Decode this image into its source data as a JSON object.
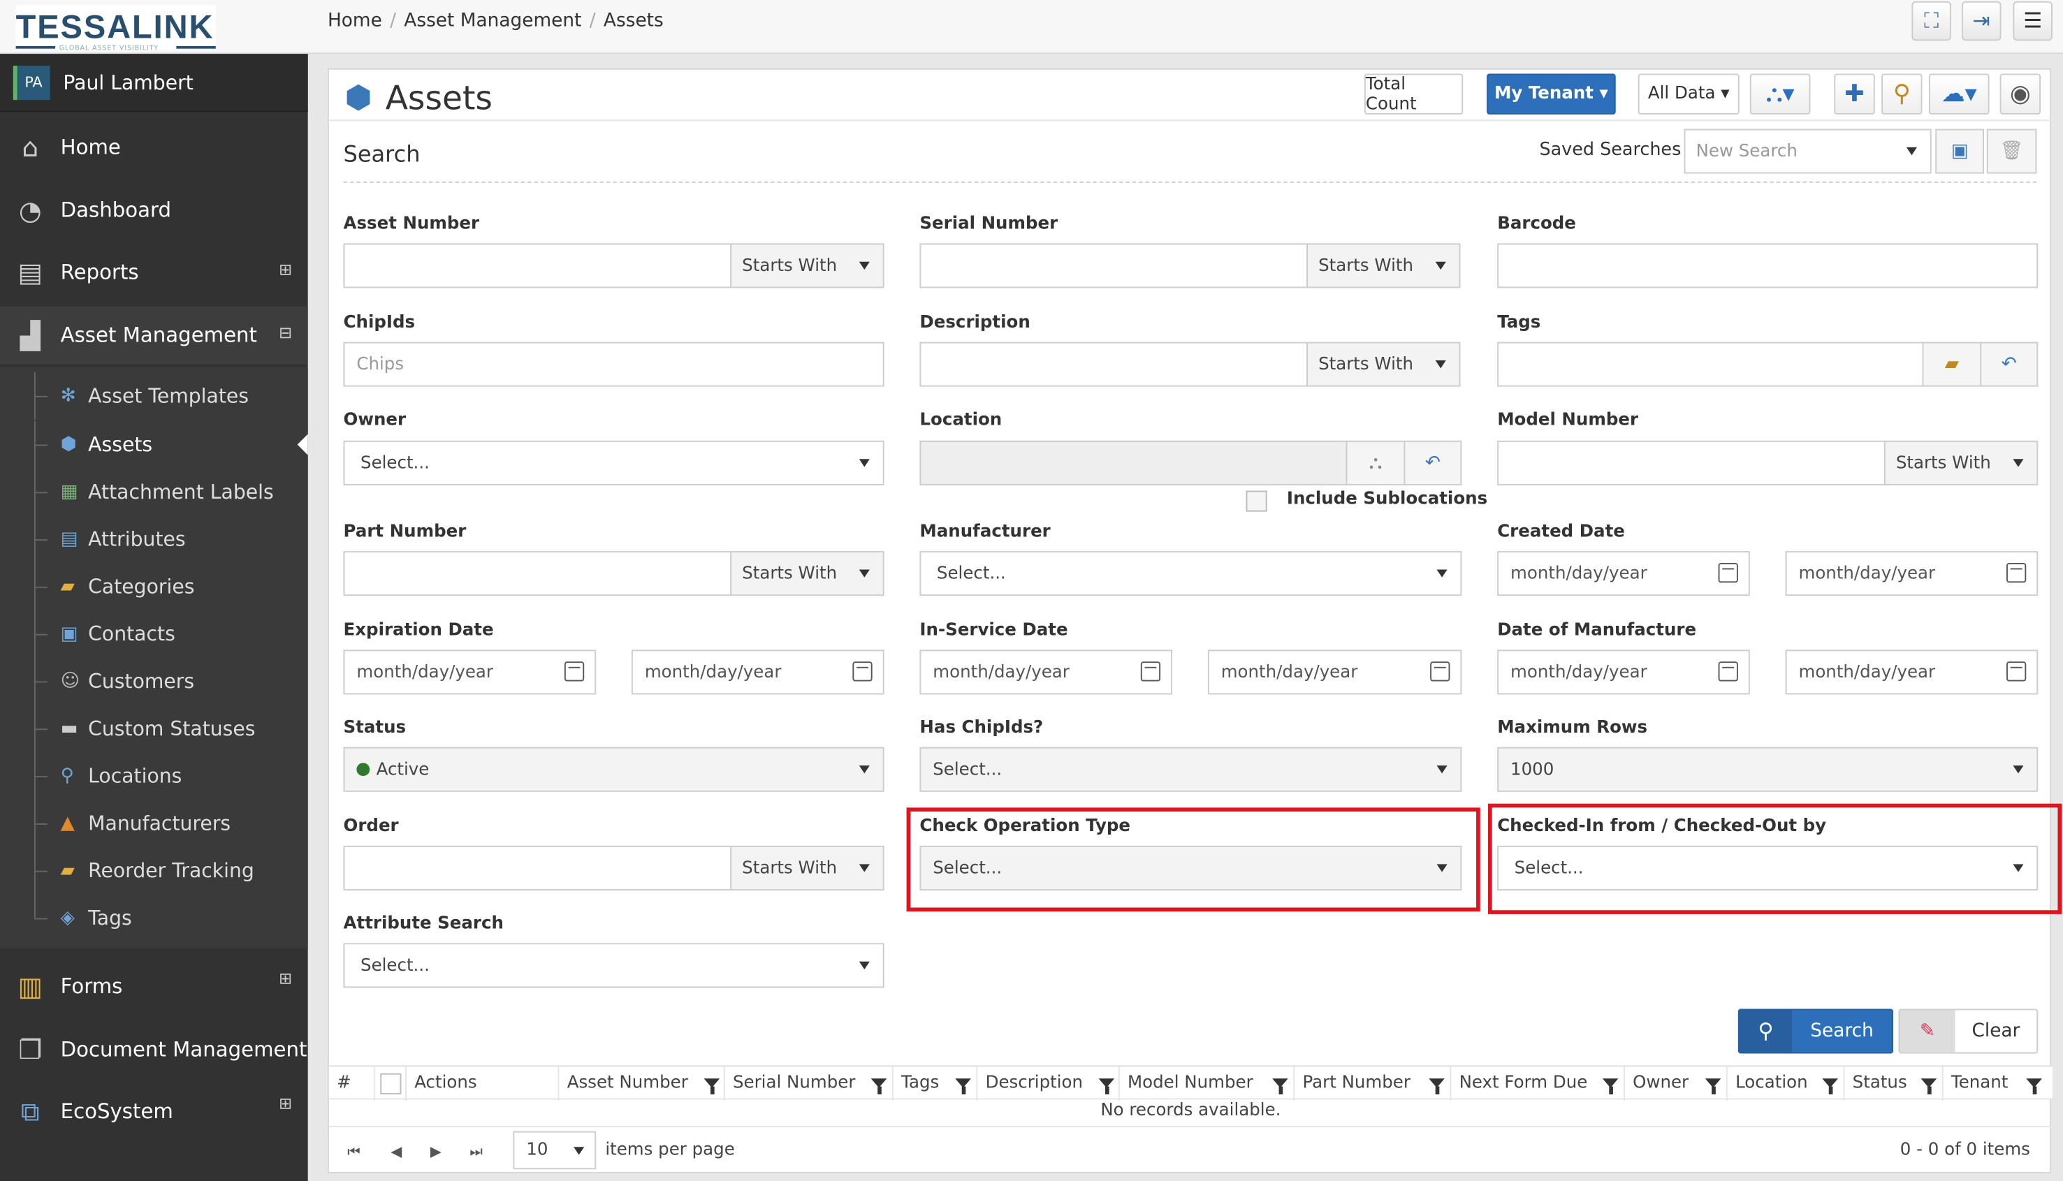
{
  "app": {
    "logo": "TESSALINK",
    "logo_tagline": "GLOBAL ASSET VISIBILITY"
  },
  "breadcrumb": [
    "Home",
    "Asset Management",
    "Assets"
  ],
  "user": {
    "initials": "PA",
    "name": "Paul Lambert"
  },
  "sidebar": {
    "items": [
      {
        "label": "Home",
        "icon": "home-icon"
      },
      {
        "label": "Dashboard",
        "icon": "dashboard-icon"
      },
      {
        "label": "Reports",
        "icon": "reports-icon"
      },
      {
        "label": "Asset Management",
        "icon": "factory-icon"
      },
      {
        "label": "Forms",
        "icon": "clipboard-icon"
      },
      {
        "label": "Document Management",
        "icon": "documents-icon"
      },
      {
        "label": "EcoSystem",
        "icon": "ecosystem-icon"
      }
    ],
    "submenu": [
      {
        "label": "Asset Templates"
      },
      {
        "label": "Assets"
      },
      {
        "label": "Attachment Labels"
      },
      {
        "label": "Attributes"
      },
      {
        "label": "Categories"
      },
      {
        "label": "Contacts"
      },
      {
        "label": "Customers"
      },
      {
        "label": "Custom Statuses"
      },
      {
        "label": "Locations"
      },
      {
        "label": "Manufacturers"
      },
      {
        "label": "Reorder Tracking"
      },
      {
        "label": "Tags"
      }
    ]
  },
  "page": {
    "title": "Assets",
    "total_count": "Total Count",
    "tenant": "My Tenant",
    "all_data": "All Data",
    "search_heading": "Search",
    "saved_searches_label": "Saved Searches",
    "saved_search_placeholder": "New Search"
  },
  "fields": {
    "asset_number": "Asset Number",
    "serial_number": "Serial Number",
    "barcode": "Barcode",
    "chipids": "ChipIds",
    "chips_placeholder": "Chips",
    "description": "Description",
    "tags": "Tags",
    "owner": "Owner",
    "location": "Location",
    "include_sublocations": "Include Sublocations",
    "model_number": "Model Number",
    "part_number": "Part Number",
    "manufacturer": "Manufacturer",
    "created_date": "Created Date",
    "expiration_date": "Expiration Date",
    "in_service_date": "In-Service Date",
    "date_of_manufacture": "Date of Manufacture",
    "status": "Status",
    "status_value": "Active",
    "has_chipids": "Has ChipIds?",
    "maximum_rows": "Maximum Rows",
    "maximum_rows_value": "1000",
    "order": "Order",
    "check_operation_type": "Check Operation Type",
    "checked_in_out": "Checked-In from / Checked-Out by",
    "attribute_search": "Attribute Search",
    "starts_with": "Starts With",
    "select": "Select...",
    "date_placeholder": "month/day/year"
  },
  "actions": {
    "search": "Search",
    "clear": "Clear"
  },
  "grid": {
    "columns": [
      "#",
      "Actions",
      "Asset Number",
      "Serial Number",
      "Tags",
      "Description",
      "Model Number",
      "Part Number",
      "Next Form Due",
      "Owner",
      "Location",
      "Status",
      "Tenant"
    ],
    "empty": "No records available.",
    "page_size": "10",
    "items_per_page": "items per page",
    "summary": "0 - 0 of 0 items"
  },
  "colors": {
    "primary": "#2d6fba",
    "sidebar": "#323232",
    "highlight": "#e0141f"
  }
}
